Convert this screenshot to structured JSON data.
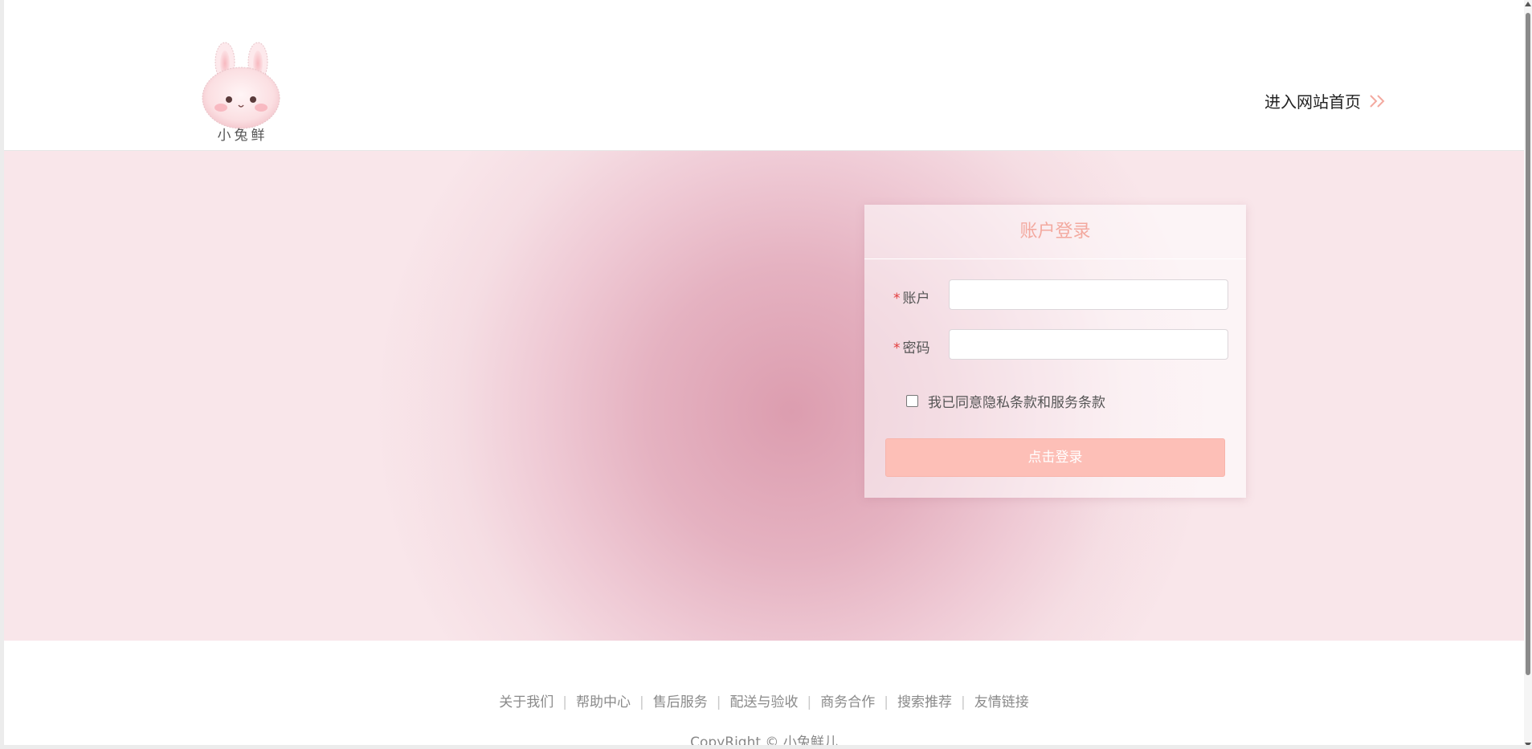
{
  "header": {
    "logo_text": "小兔鲜",
    "home_link_label": "进入网站首页",
    "accent_color": "#f3a99f"
  },
  "login": {
    "title": "账户登录",
    "account_label": "账户",
    "account_value": "",
    "password_label": "密码",
    "password_value": "",
    "required_mark": "*",
    "agree_label": "我已同意隐私条款和服务条款",
    "agree_checked": false,
    "submit_label": "点击登录",
    "button_color": "#fdbfb7"
  },
  "footer": {
    "links": [
      "关于我们",
      "帮助中心",
      "售后服务",
      "配送与验收",
      "商务合作",
      "搜索推荐",
      "友情链接"
    ],
    "separator": "|",
    "copyright": "CopyRight © 小兔鲜儿"
  }
}
